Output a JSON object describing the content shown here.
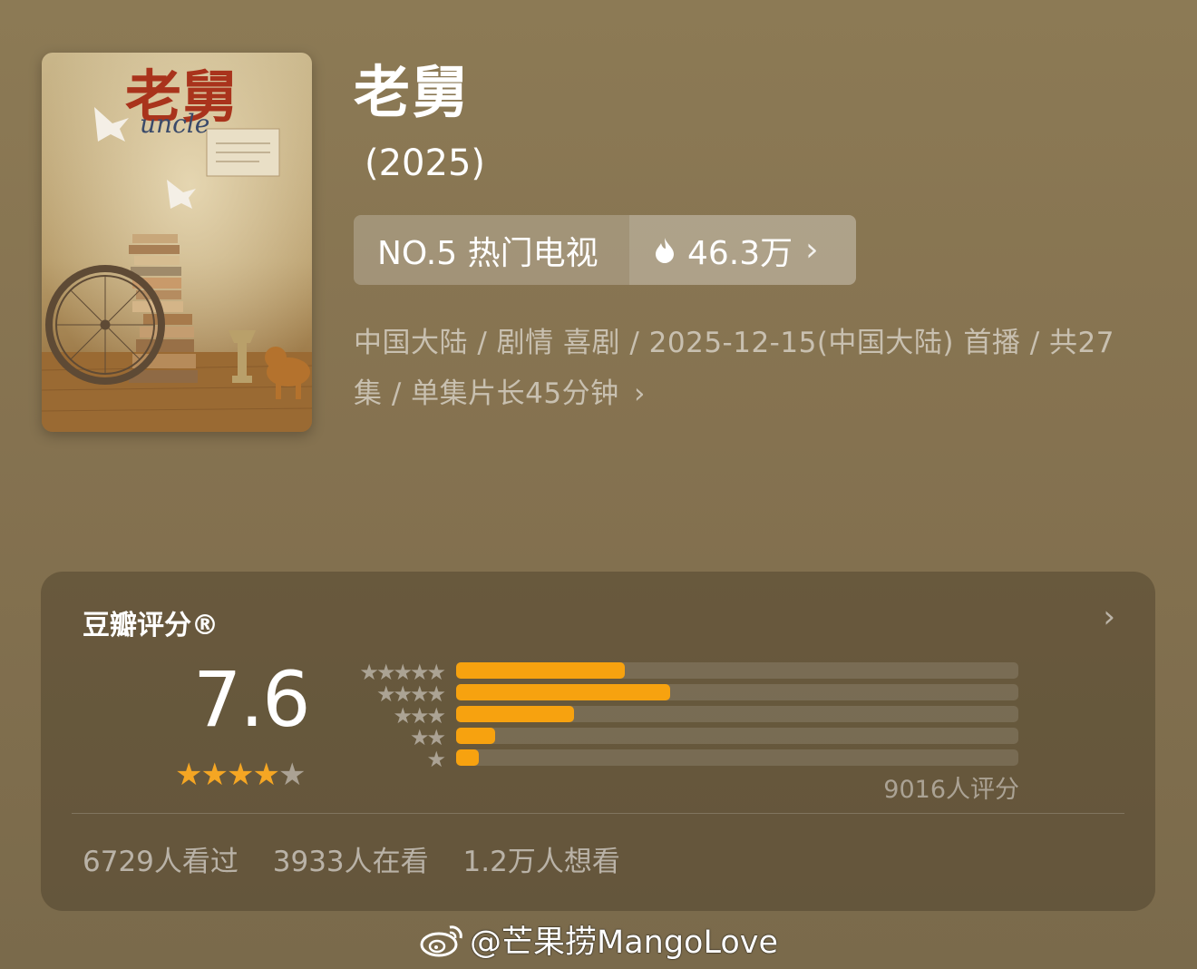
{
  "show": {
    "title": "老舅",
    "year": "(2025)",
    "poster_title": "老舅",
    "poster_subtitle": "uncle"
  },
  "rank": {
    "label": "NO.5 热门电视",
    "heat": "46.3万",
    "fire_icon": "fire-icon",
    "chevron_icon": "chevron-right-icon"
  },
  "meta": {
    "text": "中国大陆 / 剧情 喜剧 / 2025-12-15(中国大陆) 首播 / 共27集 / 单集片长45分钟"
  },
  "rating": {
    "card_title": "豆瓣评分®",
    "score": "7.6",
    "stars_filled": 4,
    "stars_total": 5,
    "rating_count": "9016人评分",
    "distribution": [
      {
        "stars": 5,
        "fraction": 0.3
      },
      {
        "stars": 4,
        "fraction": 0.38
      },
      {
        "stars": 3,
        "fraction": 0.21
      },
      {
        "stars": 2,
        "fraction": 0.07
      },
      {
        "stars": 1,
        "fraction": 0.04
      }
    ],
    "accent_color": "#f7a20f"
  },
  "stats": {
    "watched": "6729人看过",
    "watching": "3933人在看",
    "want": "1.2万人想看"
  },
  "watermark": {
    "text": "@芒果捞MangoLove"
  }
}
